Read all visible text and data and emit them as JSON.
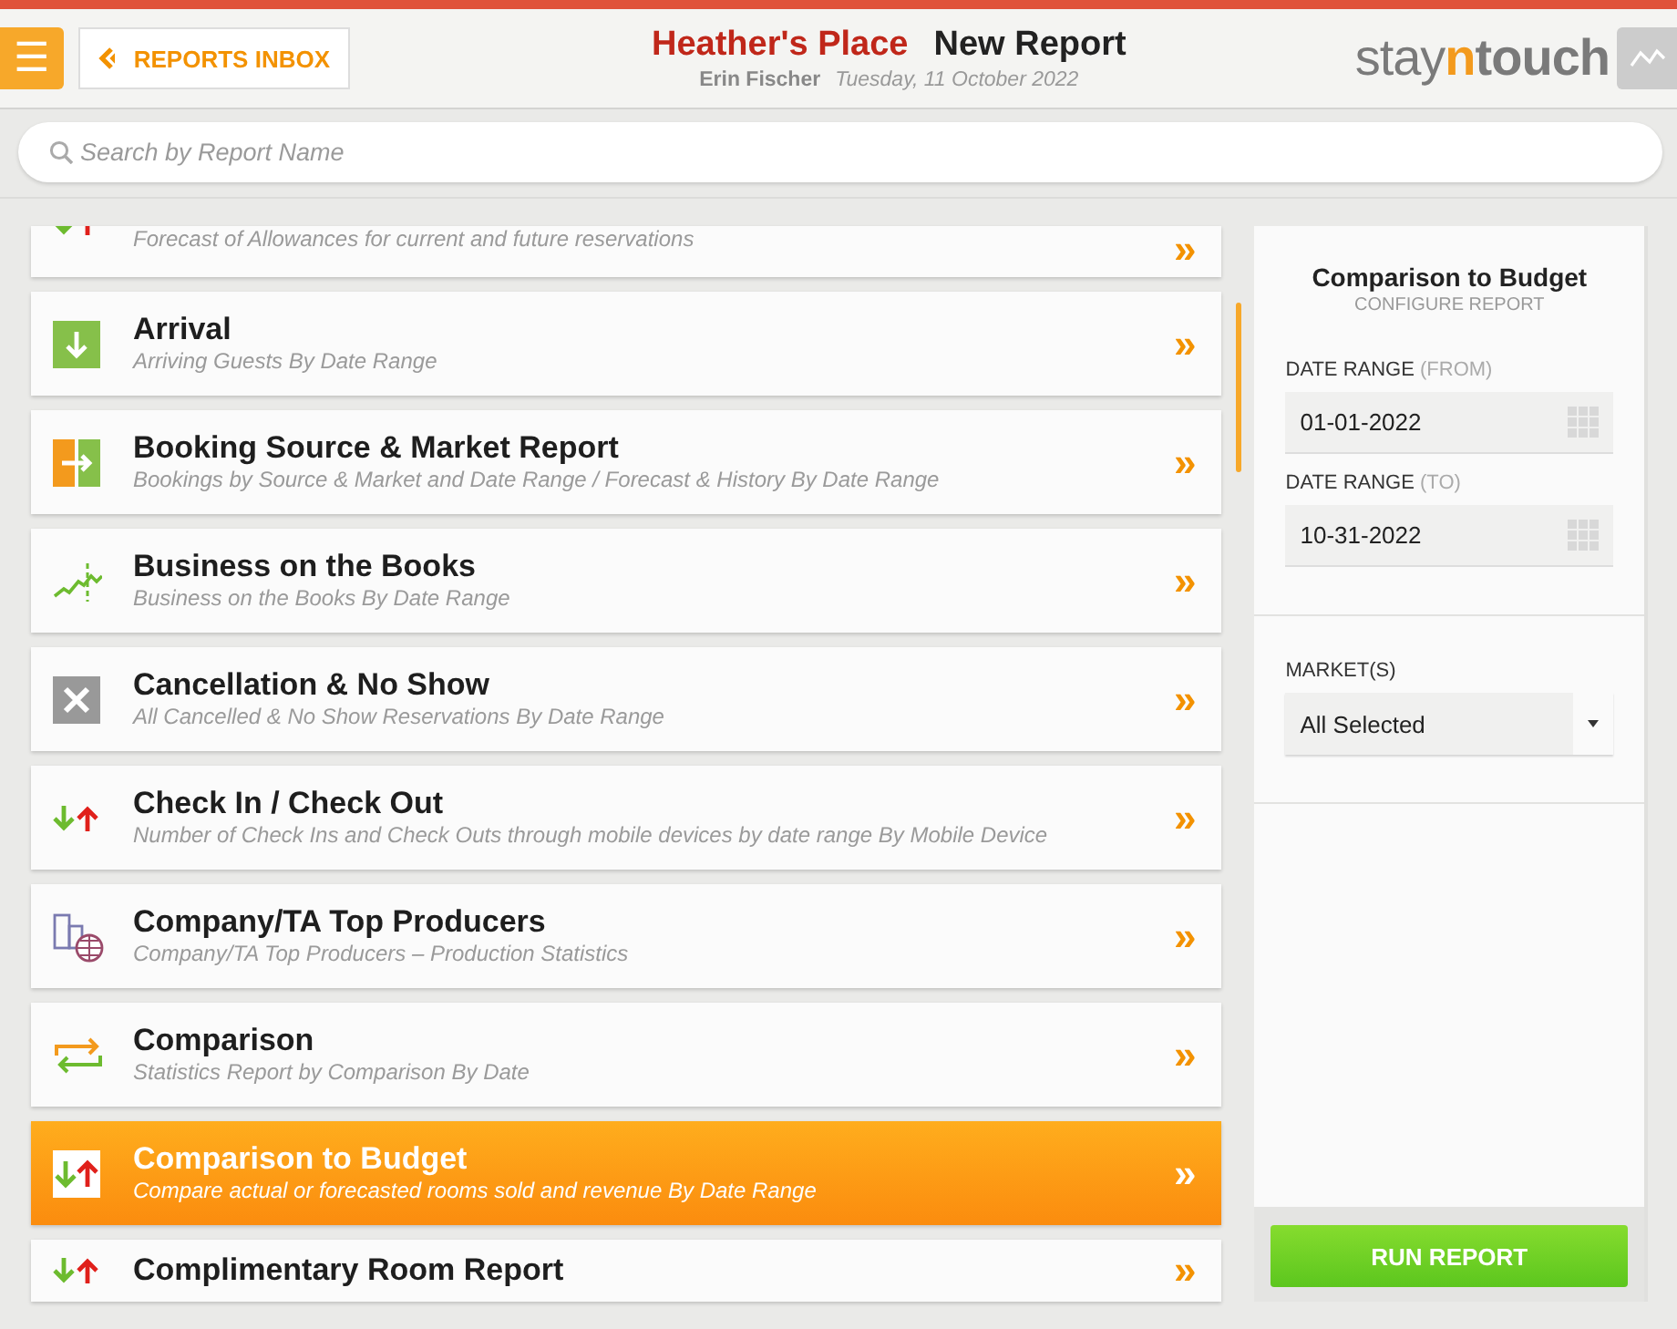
{
  "header": {
    "menu_button": "☰",
    "back_button": "REPORTS INBOX",
    "hotel": "Heather's Place",
    "page_title": "New Report",
    "user": "Erin Fischer",
    "date": "Tuesday, 11 October 2022",
    "logo": [
      "stay",
      "n",
      "touch"
    ]
  },
  "search": {
    "placeholder": "Search by Report Name"
  },
  "reports": [
    {
      "kind": "allowance",
      "description": "Forecast of Allowances for current and future reservations",
      "selected": false
    },
    {
      "kind": "arrival",
      "title": "Arrival",
      "description": "Arriving Guests By Date Range",
      "selected": false
    },
    {
      "kind": "booking",
      "title": "Booking Source & Market Report",
      "description": "Bookings by Source & Market and Date Range / Forecast & History By Date Range",
      "selected": false
    },
    {
      "kind": "books",
      "title": "Business on the Books",
      "description": "Business on the Books By Date Range",
      "selected": false
    },
    {
      "kind": "cancel",
      "title": "Cancellation & No Show",
      "description": "All Cancelled & No Show Reservations By Date Range",
      "selected": false
    },
    {
      "kind": "inout",
      "title": "Check In / Check Out",
      "description": "Number of Check Ins and Check Outs through mobile devices by date range By Mobile Device",
      "selected": false
    },
    {
      "kind": "company",
      "title": "Company/TA Top Producers",
      "description": "Company/TA Top Producers – Production Statistics",
      "selected": false
    },
    {
      "kind": "comparison",
      "title": "Comparison",
      "description": "Statistics Report by Comparison By Date",
      "selected": false
    },
    {
      "kind": "inout",
      "title": "Comparison to Budget",
      "description": "Compare actual or forecasted rooms sold and revenue By Date Range",
      "selected": true
    },
    {
      "kind": "inout",
      "title": "Complimentary Room Report",
      "selected": false
    }
  ],
  "chevron": "»",
  "config": {
    "title": "Comparison to Budget",
    "subtitle": "CONFIGURE REPORT",
    "fields": [
      {
        "kind": "date",
        "label": "DATE RANGE",
        "qualifier": "(FROM)",
        "value": "01-01-2022"
      },
      {
        "kind": "date",
        "label": "DATE RANGE",
        "qualifier": "(TO)",
        "value": "10-31-2022"
      }
    ],
    "market": {
      "label": "MARKET(S)",
      "value": "All Selected"
    },
    "run_button": "RUN REPORT"
  }
}
